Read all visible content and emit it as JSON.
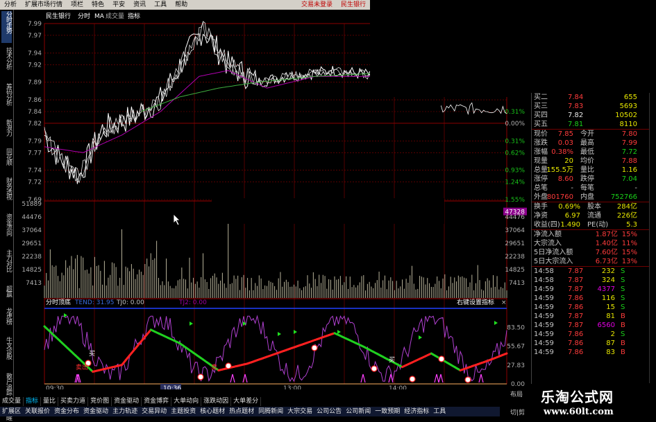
{
  "menu": [
    "分析",
    "扩展市场行情",
    "项栏",
    "特色",
    "平安",
    "资讯",
    "工具",
    "帮助"
  ],
  "menu_status": [
    "交易未登录",
    "民生银行"
  ],
  "left_tabs": [
    {
      "label": "分时走势",
      "active": true
    },
    {
      "label": "技术分析",
      "active": false
    },
    {
      "label": "筹码分析",
      "active": false
    },
    {
      "label": "新浪力",
      "active": false
    },
    {
      "label": "同花顺",
      "active": false
    },
    {
      "label": "财务透视",
      "active": false
    },
    {
      "label": "资金流向",
      "active": false
    },
    {
      "label": "主力对比",
      "active": false
    },
    {
      "label": "超赢",
      "active": false
    },
    {
      "label": "龙虎榜",
      "active": false
    },
    {
      "label": "牛叉诊股",
      "active": false
    },
    {
      "label": "散户追踪",
      "active": false
    },
    {
      "label": "提醒",
      "active": false
    }
  ],
  "chart_header": {
    "name": "民生银行",
    "mode": "分时",
    "ma": "MA",
    "vol": "成交量",
    "ind": "指标"
  },
  "price_axis_left": [
    "7.99",
    "7.97",
    "7.94",
    "7.92",
    "7.89",
    "7.86",
    "7.84",
    "7.82",
    "7.79",
    "7.77",
    "7.74",
    "7.72",
    "7.69"
  ],
  "price_axis_right": [
    "0.31%",
    "0.00%",
    "0.31%",
    "0.62%",
    "0.93%",
    "1.24%",
    "1.55%"
  ],
  "volume_axis_left": [
    "51889",
    "44476",
    "37064",
    "29651",
    "22238",
    "14825",
    "7413"
  ],
  "volume_axis_right": [
    "47328",
    "44476",
    "37064",
    "29651",
    "22238",
    "14825",
    "7413"
  ],
  "indicator_header": {
    "name": "分时顶底",
    "tend": "TEND: 31.95",
    "tj0": "TJ0: 0.00",
    "tj2": "TJ2: 0.00",
    "hint": "右键设置指标"
  },
  "indicator_axis": [
    "83.50",
    "55.67",
    "27.83",
    "0.00"
  ],
  "time_axis": [
    "09:30",
    "10:36",
    "13:00",
    "14:00"
  ],
  "indicator_labels": {
    "buy": "买",
    "sell": "卖",
    "sell2": "卖出"
  },
  "quote": {
    "bids_top": [
      {
        "label": "买二",
        "price": "7.84",
        "vol": "655"
      },
      {
        "label": "买三",
        "price": "7.83",
        "vol": "5693"
      },
      {
        "label": "买四",
        "price": "7.82",
        "vol": "10502"
      },
      {
        "label": "买五",
        "price": "7.81",
        "vol": "8110"
      }
    ],
    "stats": [
      {
        "l1": "现价",
        "v1": "7.85",
        "l2": "今开",
        "v2": "7.80"
      },
      {
        "l1": "涨跌",
        "v1": "0.03",
        "l2": "最高",
        "v2": "7.99"
      },
      {
        "l1": "涨幅",
        "v1": "0.38%",
        "l2": "最低",
        "v2": "7.72"
      },
      {
        "l1": "现量",
        "v1": "20",
        "l2": "均价",
        "v2": "7.88"
      },
      {
        "l1": "总量",
        "v1": "155.5万",
        "l2": "量比",
        "v2": "1.16"
      },
      {
        "l1": "涨停",
        "v1": "8.60",
        "l2": "跌停",
        "v2": "7.04"
      },
      {
        "l1": "总笔",
        "v1": "-",
        "l2": "每笔",
        "v2": "-"
      },
      {
        "l1": "外盘",
        "v1": "801760",
        "l2": "内盘",
        "v2": "752766"
      }
    ],
    "stats2": [
      {
        "l1": "换手",
        "v1": "0.69%",
        "l2": "股本",
        "v2": "284亿"
      },
      {
        "l1": "净资",
        "v1": "6.97",
        "l2": "流通",
        "v2": "226亿"
      },
      {
        "l1": "收益(四)",
        "v1": "1.490",
        "l2": "PE(动)",
        "v2": "5.3"
      }
    ],
    "flows": [
      {
        "label": "净流入额",
        "value": "1.87亿",
        "pct": "15%"
      },
      {
        "label": "大宗流入",
        "value": "1.40亿",
        "pct": "11%"
      },
      {
        "label": "5日净流入额",
        "value": "7.60亿",
        "pct": "15%"
      },
      {
        "label": "5日大宗流入",
        "value": "6.73亿",
        "pct": "13%"
      }
    ],
    "ticks": [
      {
        "time": "14:58",
        "price": "7.87",
        "vol": "232",
        "side": "S"
      },
      {
        "time": "14:58",
        "price": "7.87",
        "vol": "324",
        "side": "S"
      },
      {
        "time": "14:59",
        "price": "7.87",
        "vol": "4377",
        "side": "S"
      },
      {
        "time": "14:59",
        "price": "7.86",
        "vol": "116",
        "side": "S"
      },
      {
        "time": "14:59",
        "price": "7.86",
        "vol": "15",
        "side": "S"
      },
      {
        "time": "14:59",
        "price": "7.87",
        "vol": "81",
        "side": "B"
      },
      {
        "time": "14:59",
        "price": "7.87",
        "vol": "6560",
        "side": "B"
      },
      {
        "time": "14:59",
        "price": "7.86",
        "vol": "2",
        "side": "S"
      },
      {
        "time": "14:59",
        "price": "7.86",
        "vol": "87",
        "side": "B"
      },
      {
        "time": "14:59",
        "price": "7.86",
        "vol": "83",
        "side": "B"
      }
    ]
  },
  "bottom_tabs": [
    "成交量",
    "指标",
    "量比",
    "买卖力道",
    "竞价图",
    "资金驱动",
    "资金博弈",
    "大单动向",
    "涨跌动因",
    "大单差分"
  ],
  "bottom_tabs2": [
    "扩展区",
    "关联报价",
    "资金分布",
    "资金驱动",
    "主力轨迹",
    "交易异动",
    "主题投资",
    "核心题材",
    "热点题材",
    "同腾新闻",
    "大宗交易",
    "公司公告",
    "公司新闻",
    "一致预期",
    "经济指标",
    "工具"
  ],
  "corner_labels": {
    "layout": "布局",
    "cut": "切|剪"
  },
  "watermark": {
    "title": "乐淘公式网",
    "url": "www.60lt.com"
  },
  "colors": {
    "up": "#ff3b3b",
    "down": "#19d119",
    "grid": "#8b0000",
    "price_line": "#ffffff",
    "avg_line": "#d0d000",
    "ma_line": "#b000b0"
  }
}
